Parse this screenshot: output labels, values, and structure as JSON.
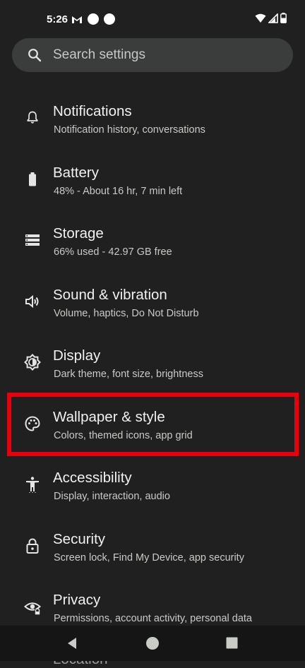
{
  "status": {
    "time": "5:26"
  },
  "search": {
    "placeholder": "Search settings"
  },
  "settings_items": [
    {
      "title": "Notifications",
      "subtitle": "Notification history, conversations",
      "icon": "bell-icon"
    },
    {
      "title": "Battery",
      "subtitle": "48% - About 16 hr, 7 min left",
      "icon": "battery-icon"
    },
    {
      "title": "Storage",
      "subtitle": "66% used - 42.97 GB free",
      "icon": "storage-icon"
    },
    {
      "title": "Sound & vibration",
      "subtitle": "Volume, haptics, Do Not Disturb",
      "icon": "speaker-icon"
    },
    {
      "title": "Display",
      "subtitle": "Dark theme, font size, brightness",
      "icon": "brightness-icon"
    },
    {
      "title": "Wallpaper & style",
      "subtitle": "Colors, themed icons, app grid",
      "icon": "palette-icon"
    },
    {
      "title": "Accessibility",
      "subtitle": "Display, interaction, audio",
      "icon": "accessibility-icon"
    },
    {
      "title": "Security",
      "subtitle": "Screen lock, Find My Device, app security",
      "icon": "lock-icon"
    },
    {
      "title": "Privacy",
      "subtitle": "Permissions, account activity, personal data",
      "icon": "eye-icon"
    }
  ],
  "peek_item": {
    "title": "Location"
  },
  "highlight": {
    "target": "Wallpaper & style",
    "color": "#e8000c"
  }
}
